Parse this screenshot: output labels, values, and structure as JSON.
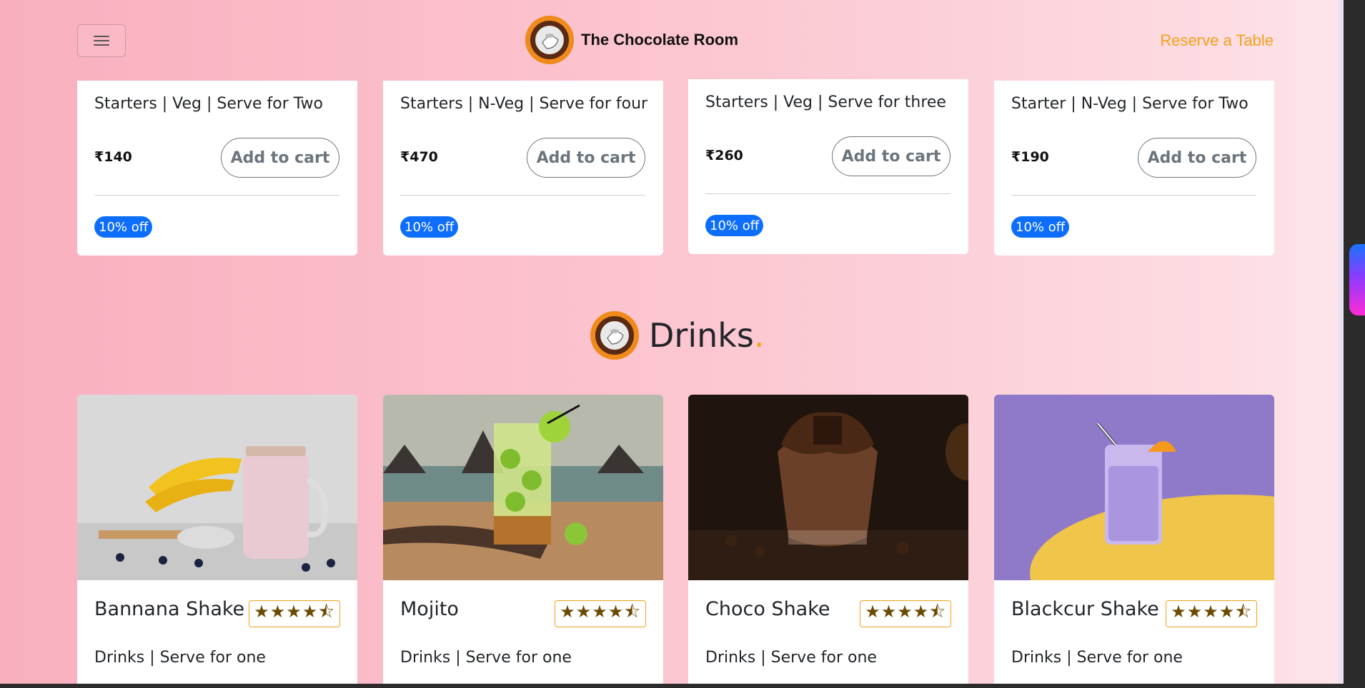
{
  "navbar": {
    "brand": "The Chocolate Room",
    "reserve_label": "Reserve a Table"
  },
  "starters": [
    {
      "desc": "Starters | Veg | Serve for Two",
      "price": "₹140",
      "cart_label": "Add to cart",
      "badge": "10% off"
    },
    {
      "desc": "Starters | N-Veg | Serve for four",
      "price": "₹470",
      "cart_label": "Add to cart",
      "badge": "10% off"
    },
    {
      "desc": "Starters | Veg | Serve for three",
      "price": "₹260",
      "cart_label": "Add to cart",
      "badge": "10% off"
    },
    {
      "desc": "Starter | N-Veg | Serve for Two",
      "price": "₹190",
      "cart_label": "Add to cart",
      "badge": "10% off"
    }
  ],
  "drinks_section": {
    "title": "Drinks",
    "title_dot": "."
  },
  "drinks": [
    {
      "name": "Bannana Shake",
      "rating": "★★★★⯪",
      "desc": "Drinks | Serve for one"
    },
    {
      "name": "Mojito",
      "rating": "★★★★⯪",
      "desc": "Drinks | Serve for one"
    },
    {
      "name": "Choco Shake",
      "rating": "★★★★⯪",
      "desc": "Drinks | Serve for one"
    },
    {
      "name": "Blackcur Shake",
      "rating": "★★★★⯪",
      "desc": "Drinks | Serve for one"
    }
  ],
  "colors": {
    "accent": "#f4a11a",
    "badge": "#0d6efd"
  },
  "icons": {
    "menu": "hamburger-icon",
    "logo": "chocolate-room-logo"
  }
}
